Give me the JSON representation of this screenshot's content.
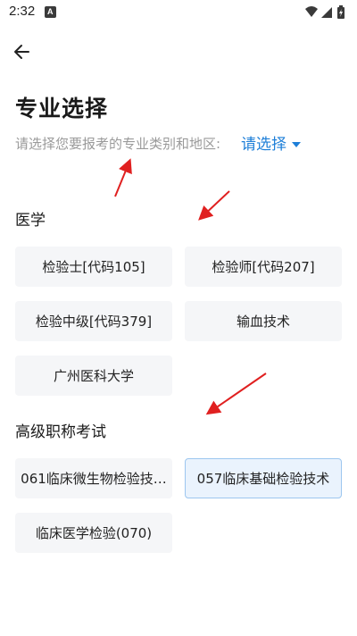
{
  "status": {
    "time": "2:32",
    "notification_icon": "A"
  },
  "header": {
    "back_icon": "arrow-left-icon"
  },
  "page": {
    "title": "专业选择",
    "subtitle": "请选择您要报考的专业类别和地区:",
    "region_select_label": "请选择"
  },
  "sections": [
    {
      "title": "医学",
      "options": [
        {
          "label": "检验士[代码105]"
        },
        {
          "label": "检验师[代码207]"
        },
        {
          "label": "检验中级[代码379]"
        },
        {
          "label": "输血技术"
        },
        {
          "label": "广州医科大学"
        }
      ]
    },
    {
      "title": "高级职称考试",
      "options": [
        {
          "label": "061临床微生物检验技…"
        },
        {
          "label": "057临床基础检验技术",
          "selected": true
        },
        {
          "label": "临床医学检验(070)"
        }
      ]
    }
  ],
  "colors": {
    "accent": "#1e7fd8",
    "annotation_arrow": "#e02020",
    "option_bg": "#f5f6f8",
    "selected_bg": "#eaf3fd"
  }
}
